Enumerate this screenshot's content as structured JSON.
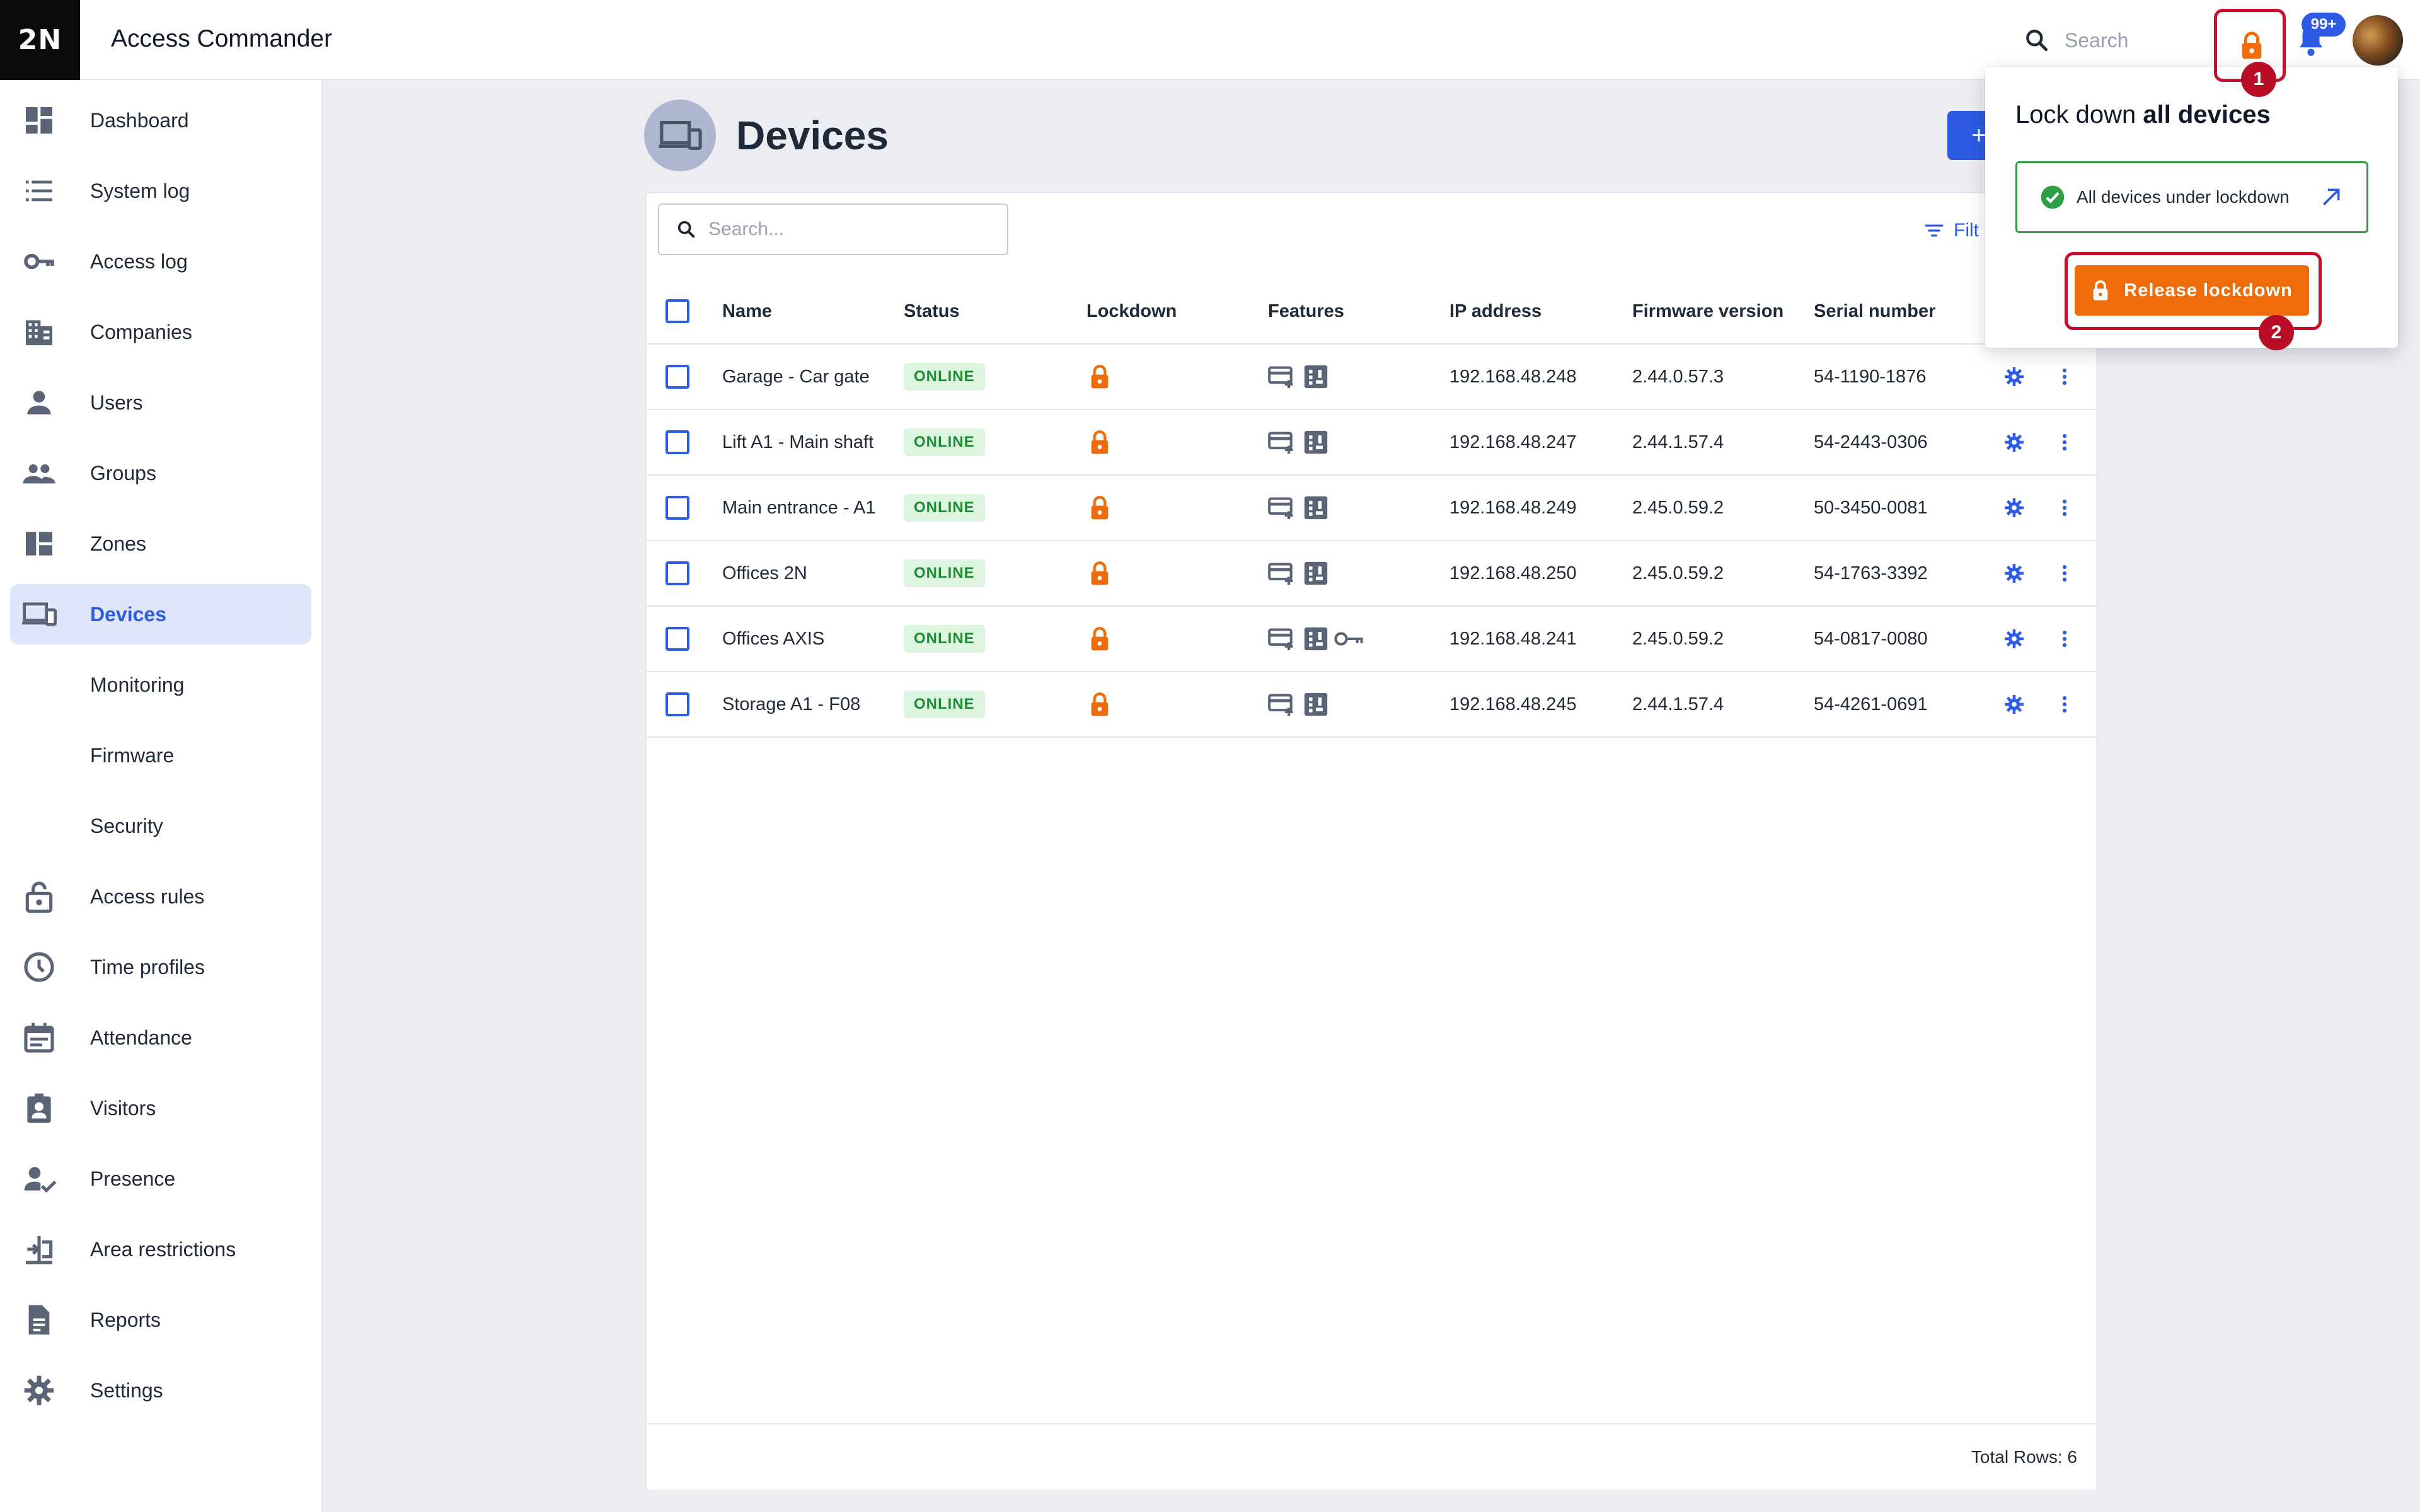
{
  "app": {
    "logo_text": "2N",
    "title": "Access Commander",
    "search_label": "Search",
    "notification_badge": "99+"
  },
  "sidebar": {
    "items": [
      {
        "label": "Dashboard",
        "icon": "dashboard-icon"
      },
      {
        "label": "System log",
        "icon": "list-icon"
      },
      {
        "label": "Access log",
        "icon": "key-icon"
      },
      {
        "label": "Companies",
        "icon": "building-icon"
      },
      {
        "label": "Users",
        "icon": "person-icon"
      },
      {
        "label": "Groups",
        "icon": "people-icon"
      },
      {
        "label": "Zones",
        "icon": "zones-icon"
      },
      {
        "label": "Devices",
        "icon": "devices-icon",
        "active": true
      },
      {
        "label": "Monitoring"
      },
      {
        "label": "Firmware"
      },
      {
        "label": "Security"
      },
      {
        "label": "Access rules",
        "icon": "lock-open-icon"
      },
      {
        "label": "Time profiles",
        "icon": "clock-icon"
      },
      {
        "label": "Attendance",
        "icon": "calendar-icon"
      },
      {
        "label": "Visitors",
        "icon": "badge-icon"
      },
      {
        "label": "Presence",
        "icon": "person-check-icon"
      },
      {
        "label": "Area restrictions",
        "icon": "area-icon"
      },
      {
        "label": "Reports",
        "icon": "document-icon"
      },
      {
        "label": "Settings",
        "icon": "gear-icon"
      }
    ]
  },
  "page": {
    "title": "Devices",
    "add_label": "+",
    "search_placeholder": "Search...",
    "filter_label": "Filt"
  },
  "table": {
    "columns": [
      "Name",
      "Status",
      "Lockdown",
      "Features",
      "IP address",
      "Firmware version",
      "Serial number"
    ],
    "rows": [
      {
        "name": "Garage - Car gate",
        "status": "ONLINE",
        "ip": "192.168.48.248",
        "firmware": "2.44.0.57.3",
        "serial": "54-1190-1876",
        "key": false
      },
      {
        "name": "Lift A1 - Main shaft",
        "status": "ONLINE",
        "ip": "192.168.48.247",
        "firmware": "2.44.1.57.4",
        "serial": "54-2443-0306",
        "key": false
      },
      {
        "name": "Main entrance - A1",
        "status": "ONLINE",
        "ip": "192.168.48.249",
        "firmware": "2.45.0.59.2",
        "serial": "50-3450-0081",
        "key": false
      },
      {
        "name": "Offices 2N",
        "status": "ONLINE",
        "ip": "192.168.48.250",
        "firmware": "2.45.0.59.2",
        "serial": "54-1763-3392",
        "key": false
      },
      {
        "name": "Offices AXIS",
        "status": "ONLINE",
        "ip": "192.168.48.241",
        "firmware": "2.45.0.59.2",
        "serial": "54-0817-0080",
        "key": true
      },
      {
        "name": "Storage A1 - F08",
        "status": "ONLINE",
        "ip": "192.168.48.245",
        "firmware": "2.44.1.57.4",
        "serial": "54-4261-0691",
        "key": false
      }
    ],
    "total_rows": "Total Rows: 6"
  },
  "lockdown_popover": {
    "title_prefix": "Lock down ",
    "title_bold": "all devices",
    "status_text": "All devices under lockdown",
    "release_label": "Release lockdown"
  },
  "annotations": {
    "step1": "1",
    "step2": "2"
  },
  "colors": {
    "accent": "#2d5be3",
    "lockdown_orange": "#ef6c0a",
    "online_green": "#1e8a35",
    "highlight_red": "#c8102e"
  }
}
